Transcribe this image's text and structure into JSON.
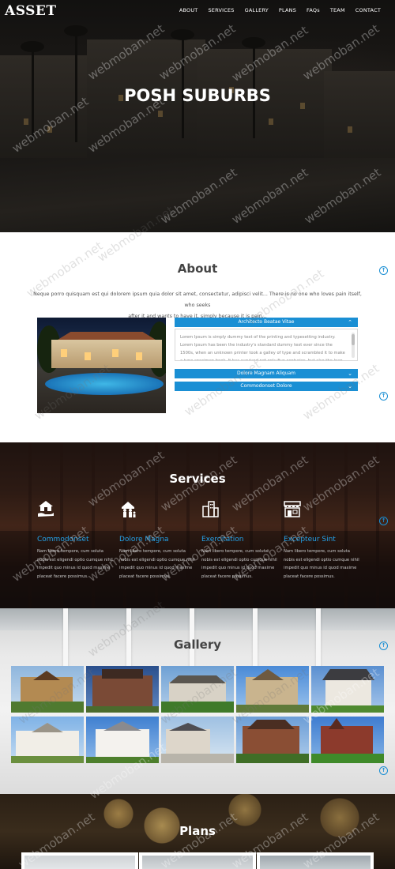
{
  "brand": "ASSET",
  "nav": [
    "ABOUT",
    "SERVICES",
    "GALLERY",
    "PLANS",
    "FAQs",
    "TEAM",
    "CONTACT"
  ],
  "hero": {
    "title": "POSH SUBURBS"
  },
  "about": {
    "title": "About",
    "text_line1": "Neque porro quisquam est qui dolorem ipsum quia dolor sit amet, consectetur, adipisci velit... There is no one who loves pain itself, who seeks",
    "text_line2": "after it and wants to have it, simply because it is pain...",
    "accordion": [
      {
        "title": "Architecto Beatae Vitae",
        "body": "Lorem Ipsum is simply dummy text of the printing and typesetting industry. Lorem Ipsum has been the industry's standard dummy text ever since the 1500s, when an unknown printer took a galley of type and scrambled it to make a type specimen book. It has survived not only five centuries, but also the leap into electronic typesetting, remaining"
      },
      {
        "title": "Dolore Magnam Aliquam"
      },
      {
        "title": "Commodonset Dolore"
      }
    ]
  },
  "services": {
    "title": "Services",
    "items": [
      {
        "name": "Commodonset",
        "icon": "house-hand-icon",
        "desc": "Nam libero tempore, cum soluta nobis est eligendi optio cumque nihil impedit quo minus id quod maxime placeat facere possimus."
      },
      {
        "name": "Dolore Magna",
        "icon": "family-house-icon",
        "desc": "Nam libero tempore, cum soluta nobis est eligendi optio cumque nihil impedit quo minus id quod maxime placeat facere possimus."
      },
      {
        "name": "Exercitation",
        "icon": "buildings-icon",
        "desc": "Nam libero tempore, cum soluta nobis est eligendi optio cumque nihil impedit quo minus id quod maxime placeat facere possimus."
      },
      {
        "name": "Excepteur Sint",
        "icon": "storefront-icon",
        "desc": "Nam libero tempore, cum soluta nobis est eligendi optio cumque nihil impedit quo minus id quod maxime placeat facere possimus."
      }
    ]
  },
  "gallery": {
    "title": "Gallery"
  },
  "plans": {
    "title": "Plans"
  },
  "watermark": "webmoban.net",
  "colors": {
    "accent": "#1a8fd4",
    "service_title": "#23a1e8"
  }
}
